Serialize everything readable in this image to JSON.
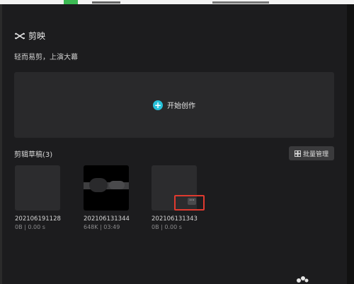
{
  "app": {
    "name": "剪映",
    "tagline": "轻而易剪，上演大幕"
  },
  "create": {
    "label": "开始创作"
  },
  "drafts": {
    "title": "剪辑草稿(3)",
    "batch_label": "批量管理",
    "items": [
      {
        "name": "202106191128",
        "meta": "0B | 0.00 s"
      },
      {
        "name": "202106131344",
        "meta": "648K | 03:49"
      },
      {
        "name": "202106131343",
        "meta": "0B | 0.00 s"
      }
    ],
    "more_label": "···"
  },
  "colors": {
    "accent": "#27c1d9",
    "highlight": "#e03a2f",
    "background": "#1c1c1e"
  }
}
